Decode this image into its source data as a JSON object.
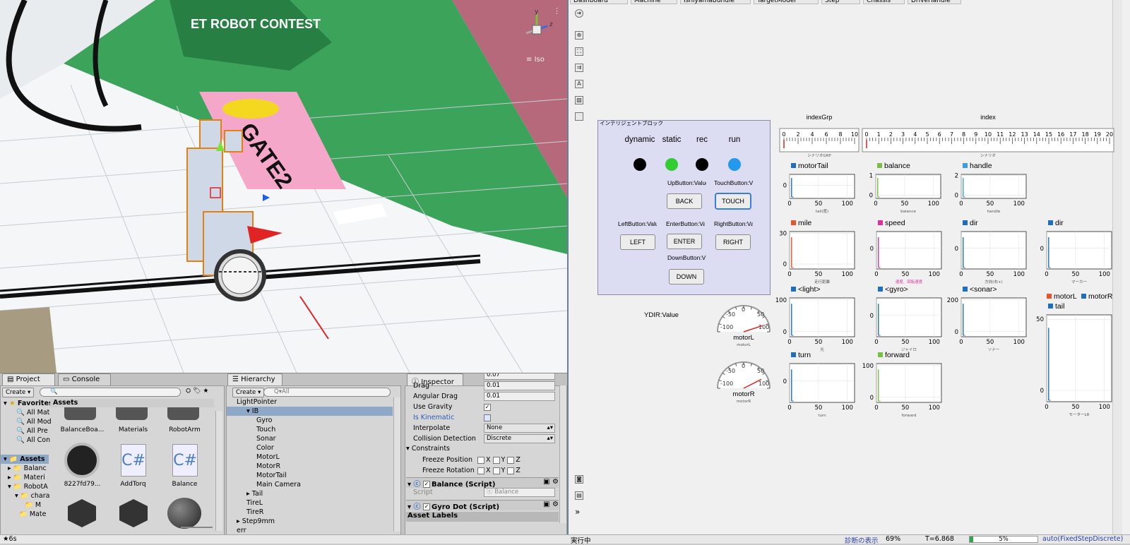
{
  "scene": {
    "view_mode": "Iso",
    "axes": {
      "y": "y",
      "x": "x",
      "z": "z"
    },
    "floor_text": "GATE2",
    "logo_text": "ET ROBOT CONTEST"
  },
  "project_panel": {
    "tabs": [
      "Project",
      "Console"
    ],
    "create": "Create",
    "favorites": {
      "label": "Favorites",
      "items": [
        "All Mat",
        "All Mod",
        "All Pre",
        "All Con"
      ]
    },
    "assets_tree": {
      "label": "Assets",
      "items": [
        "Balanc",
        "Materi",
        "RobotA",
        "chara",
        "M",
        "Mate"
      ]
    },
    "assets_header": "Assets",
    "assets_row1": [
      "BalanceBoa...",
      "Materials",
      "RobotArm"
    ],
    "assets_row2": [
      "8227fd79...",
      "AddTorq",
      "Balance"
    ]
  },
  "hierarchy_panel": {
    "tab": "Hierarchy",
    "create": "Create",
    "search_placeholder": "All",
    "items": [
      {
        "label": "LightPointer",
        "indent": 1
      },
      {
        "label": "IB",
        "indent": 2,
        "selected": true
      },
      {
        "label": "Gyro",
        "indent": 3
      },
      {
        "label": "Touch",
        "indent": 3
      },
      {
        "label": "Sonar",
        "indent": 3
      },
      {
        "label": "Color",
        "indent": 3
      },
      {
        "label": "MotorL",
        "indent": 3
      },
      {
        "label": "MotorR",
        "indent": 3
      },
      {
        "label": "MotorTail",
        "indent": 3
      },
      {
        "label": "Main Camera",
        "indent": 3
      },
      {
        "label": "Tail",
        "indent": 2
      },
      {
        "label": "TireL",
        "indent": 2
      },
      {
        "label": "TireR",
        "indent": 2
      },
      {
        "label": "Step9mm",
        "indent": 1
      },
      {
        "label": "err",
        "indent": 1
      }
    ]
  },
  "inspector_panel": {
    "tab": "Inspector",
    "props": {
      "mass_value": "0.07",
      "drag_label": "Drag",
      "drag_value": "0.01",
      "angular_drag_label": "Angular Drag",
      "angular_drag_value": "0.01",
      "use_gravity_label": "Use Gravity",
      "is_kinematic_label": "Is Kinematic",
      "interpolate_label": "Interpolate",
      "interpolate_value": "None",
      "collision_label": "Collision Detection",
      "collision_value": "Discrete",
      "constraints_label": "Constraints",
      "freeze_pos_label": "Freeze Position",
      "freeze_rot_label": "Freeze Rotation",
      "axis_x": "X",
      "axis_y": "Y",
      "axis_z": "Z"
    },
    "balance_script": "Balance (Script)",
    "script_label": "Script",
    "script_value": "Balance",
    "gyro_script": "Gyro Dot (Script)",
    "asset_labels": "Asset Labels"
  },
  "matlab": {
    "tabs": [
      "Dashboard",
      "Machine",
      "IshiyamaBundle",
      "TargetModel",
      "Step",
      "Chassis",
      "DriveHandle"
    ],
    "panel_title": "インテリジェントブロック",
    "lamps": [
      {
        "label": "dynamic",
        "color": "#000000"
      },
      {
        "label": "static",
        "color": "#33cc33"
      },
      {
        "label": "rec",
        "color": "#000000"
      },
      {
        "label": "run",
        "color": "#2299ee"
      }
    ],
    "button_labels": {
      "up": "UpButton:Value",
      "touch": "TouchButton:V",
      "left": "LeftButton:Valu",
      "enter": "EnterButton:Va",
      "right": "RightButton:Va",
      "down": "DownButton:V"
    },
    "buttons": {
      "back": "BACK",
      "touch": "TOUCH",
      "left": "LEFT",
      "enter": "ENTER",
      "right": "RIGHT",
      "down": "DOWN"
    },
    "ydir_label": "YDIR:Value",
    "gauges": [
      {
        "name": "motorL",
        "sub": "motorL",
        "value": 80
      },
      {
        "name": "motorR",
        "sub": "motorR",
        "value": 70
      }
    ],
    "gauge_ticks": [
      "-50",
      "0",
      "50",
      "-100",
      "100"
    ],
    "index_rulers": [
      {
        "title": "indexGrp",
        "caption": "シナリオGRP",
        "ticks": [
          "0",
          "2",
          "4",
          "6",
          "8",
          "10"
        ]
      },
      {
        "title": "index",
        "caption": "シナリオ",
        "ticks": [
          "0",
          "1",
          "2",
          "3",
          "4",
          "5",
          "6",
          "7",
          "8",
          "9",
          "10",
          "11",
          "12",
          "13",
          "14",
          "15",
          "16",
          "17",
          "18",
          "19",
          "20"
        ]
      }
    ],
    "status": {
      "left": "実行中",
      "diag": "診断の表示",
      "percent": "69%",
      "time": "T=6.868",
      "progress": "5%",
      "progress_value": 5,
      "mode": "auto(FixedStepDiscrete)"
    }
  },
  "chart_data": [
    {
      "type": "line",
      "title": "motorTail",
      "color": "#1f6fc0",
      "xlim": [
        0,
        100
      ],
      "xticks": [
        "0",
        "50",
        "100"
      ],
      "yticks": [
        "0"
      ],
      "xlabel": "tail(度)",
      "series": [
        {
          "name": "motorTail",
          "values": []
        }
      ]
    },
    {
      "type": "line",
      "title": "balance",
      "color": "#77c043",
      "xlim": [
        0,
        100
      ],
      "xticks": [
        "0",
        "50",
        "100"
      ],
      "yticks": [
        "1",
        "0"
      ],
      "xlabel": "balance",
      "series": [
        {
          "name": "balance",
          "values": []
        }
      ]
    },
    {
      "type": "line",
      "title": "handle",
      "color": "#3a9ee0",
      "xlim": [
        0,
        100
      ],
      "xticks": [
        "0",
        "50",
        "100"
      ],
      "yticks": [
        "2",
        "0"
      ],
      "xlabel": "handle",
      "series": [
        {
          "name": "handle",
          "values": []
        }
      ]
    },
    {
      "type": "line",
      "title": "mile",
      "color": "#e8542a",
      "xlim": [
        0,
        100
      ],
      "xticks": [
        "0",
        "50",
        "100"
      ],
      "yticks": [
        "30",
        "0"
      ],
      "xlabel": "走行距離",
      "series": [
        {
          "name": "mile",
          "values": []
        }
      ]
    },
    {
      "type": "line",
      "title": "speed",
      "color": "#e02e9c",
      "xlim": [
        0,
        100
      ],
      "xticks": [
        "0",
        "50",
        "100"
      ],
      "yticks": [
        "0"
      ],
      "xlabel": "速度、回転速度",
      "series": [
        {
          "name": "speed",
          "values": []
        }
      ]
    },
    {
      "type": "line",
      "title": "dir",
      "color": "#1f6fc0",
      "xlim": [
        0,
        100
      ],
      "xticks": [
        "0",
        "50",
        "100"
      ],
      "yticks": [
        "0"
      ],
      "xlabel": "方向(右+)",
      "series": [
        {
          "name": "dir",
          "values": []
        }
      ]
    },
    {
      "type": "line",
      "title": "dir",
      "color": "#1f6fc0",
      "xlim": [
        0,
        100
      ],
      "xticks": [
        "0",
        "50",
        "100"
      ],
      "yticks": [
        "0"
      ],
      "xlabel": "マーカー",
      "series": [
        {
          "name": "dir",
          "values": []
        }
      ]
    },
    {
      "type": "line",
      "title": "<light>",
      "color": "#1f6fc0",
      "xlim": [
        0,
        100
      ],
      "xticks": [
        "0",
        "50",
        "100"
      ],
      "yticks": [
        "100",
        "0"
      ],
      "xlabel": "光",
      "series": [
        {
          "name": "<light>",
          "values": []
        }
      ]
    },
    {
      "type": "line",
      "title": "<gyro>",
      "color": "#1f6fc0",
      "xlim": [
        0,
        100
      ],
      "xticks": [
        "0",
        "50",
        "100"
      ],
      "yticks": [
        "0"
      ],
      "xlabel": "ジャイロ",
      "series": [
        {
          "name": "<gyro>",
          "values": []
        }
      ]
    },
    {
      "type": "line",
      "title": "<sonar>",
      "color": "#1f6fc0",
      "xlim": [
        0,
        100
      ],
      "xticks": [
        "0",
        "50",
        "100"
      ],
      "yticks": [
        "200",
        "0"
      ],
      "xlabel": "ソナー",
      "series": [
        {
          "name": "<sonar>",
          "values": []
        }
      ]
    },
    {
      "type": "line",
      "title": "turn",
      "color": "#1f6fc0",
      "xlim": [
        0,
        100
      ],
      "xticks": [
        "0",
        "50",
        "100"
      ],
      "yticks": [
        "0"
      ],
      "xlabel": "turn",
      "series": [
        {
          "name": "turn",
          "values": []
        }
      ]
    },
    {
      "type": "line",
      "title": "forward",
      "color": "#77c043",
      "xlim": [
        0,
        100
      ],
      "xticks": [
        "0",
        "50",
        "100"
      ],
      "yticks": [
        "100",
        "0"
      ],
      "xlabel": "forward",
      "series": [
        {
          "name": "forward",
          "values": []
        }
      ]
    },
    {
      "type": "line",
      "title": "tail",
      "legend": [
        "motorL",
        "motorR",
        "tail"
      ],
      "legend_colors": [
        "#e8542a",
        "#1f6fc0",
        "#1f6fc0"
      ],
      "color": "#1f6fc0",
      "xlim": [
        0,
        100
      ],
      "xticks": [
        "0",
        "50",
        "100"
      ],
      "yticks": [
        "50",
        "0"
      ],
      "xlabel": "モーターLR",
      "series": [
        {
          "name": "motorL",
          "values": []
        },
        {
          "name": "motorR",
          "values": []
        },
        {
          "name": "tail",
          "values": []
        }
      ]
    }
  ],
  "footer": {
    "left": "6s"
  }
}
